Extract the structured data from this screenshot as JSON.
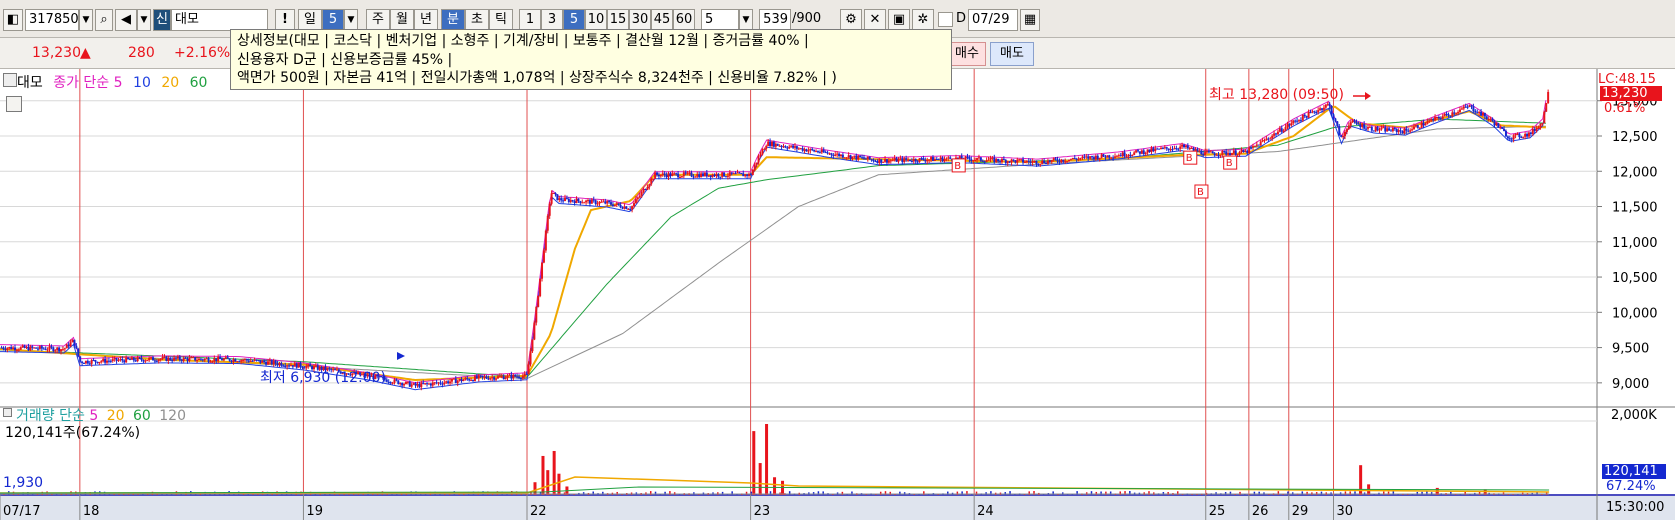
{
  "toolbar": {
    "code": "317850",
    "credit_tag": "신",
    "stock_name": "대모",
    "period_buttons": [
      "일",
      "5",
      "주",
      "월",
      "년",
      "분",
      "초",
      "틱"
    ],
    "minute_buttons": [
      "1",
      "3",
      "5",
      "10",
      "15",
      "30",
      "45",
      "60"
    ],
    "interval_value": "5",
    "count_value": "539",
    "count_total": "/900",
    "check_label": "D",
    "date_value": "07/29"
  },
  "quote": {
    "price": "13,230",
    "direction": "▲",
    "change": "280",
    "change_pct": "+2.16%",
    "buy_label": "매수",
    "sell_label": "매도"
  },
  "tooltip": {
    "line1": "상세정보(대모  |  코스닥  |  벤처기업  |  소형주  |  기계/장비  |  보통주  |  결산월  12월  |  증거금률  40%  |",
    "line2": "신용융자 D군  |  신용보증금률  45%  |",
    "line3": "액면가 500원  |  자본금  41억  |  전일시가총액  1,078억  |  상장주식수  8,324천주  |  신용비율  7.82%  |  )"
  },
  "price_legend": {
    "name": "대모",
    "title": "종가 단순",
    "periods": [
      "5",
      "10",
      "20",
      "60"
    ]
  },
  "volume_legend": {
    "title": "거래량 단순",
    "periods": [
      "5",
      "20",
      "60",
      "120"
    ],
    "value_text": "120,141주(67.24%)",
    "low_text": "1,930"
  },
  "annotations": {
    "high": "최고 13,280 (09:50)",
    "low": "최저 6,930 (12:00)",
    "signal": "B"
  },
  "right_axis": {
    "top_label": "LC:48.15",
    "price_box": "13,230",
    "pct_label": "0.61%",
    "volume_box": "120,141",
    "volume_pct": "67.24%",
    "volume_max": "2,000K",
    "time": "15:30:00"
  },
  "colors": {
    "up": "#e8141c",
    "down": "#1428d0",
    "ma5": "#e020c0",
    "ma10": "#2040e0",
    "ma20": "#f0a800",
    "ma60": "#20a040",
    "ma120": "#909090",
    "separator": "#e05050"
  },
  "chart_data": {
    "type": "candlestick",
    "y_axis": {
      "ticks": [
        "13,000",
        "12,500",
        "12,000",
        "11,500",
        "11,000",
        "10,500",
        "10,000",
        "9,500",
        "9,000"
      ],
      "ylim": [
        8700,
        13450
      ]
    },
    "x_labels": [
      {
        "label": "07/17",
        "x": 0
      },
      {
        "label": "18",
        "x": 0.05
      },
      {
        "label": "19",
        "x": 0.19
      },
      {
        "label": "22",
        "x": 0.33
      },
      {
        "label": "23",
        "x": 0.47
      },
      {
        "label": "24",
        "x": 0.61
      },
      {
        "label": "25",
        "x": 0.755
      },
      {
        "label": "26",
        "x": 0.782
      },
      {
        "label": "29",
        "x": 0.807
      },
      {
        "label": "30",
        "x": 0.835
      }
    ],
    "close_path": [
      [
        0,
        9500
      ],
      [
        0.04,
        9480
      ],
      [
        0.046,
        9600
      ],
      [
        0.05,
        9300
      ],
      [
        0.1,
        9340
      ],
      [
        0.15,
        9330
      ],
      [
        0.19,
        9240
      ],
      [
        0.23,
        9100
      ],
      [
        0.26,
        8960
      ],
      [
        0.3,
        9070
      ],
      [
        0.33,
        9100
      ],
      [
        0.335,
        9900
      ],
      [
        0.34,
        10800
      ],
      [
        0.345,
        11700
      ],
      [
        0.35,
        11600
      ],
      [
        0.38,
        11550
      ],
      [
        0.395,
        11480
      ],
      [
        0.41,
        11950
      ],
      [
        0.47,
        11950
      ],
      [
        0.475,
        12200
      ],
      [
        0.48,
        12400
      ],
      [
        0.52,
        12250
      ],
      [
        0.55,
        12150
      ],
      [
        0.6,
        12180
      ],
      [
        0.65,
        12130
      ],
      [
        0.7,
        12230
      ],
      [
        0.74,
        12350
      ],
      [
        0.755,
        12250
      ],
      [
        0.78,
        12270
      ],
      [
        0.81,
        12700
      ],
      [
        0.832,
        12950
      ],
      [
        0.84,
        12450
      ],
      [
        0.845,
        12700
      ],
      [
        0.86,
        12600
      ],
      [
        0.88,
        12570
      ],
      [
        0.9,
        12750
      ],
      [
        0.92,
        12920
      ],
      [
        0.935,
        12700
      ],
      [
        0.945,
        12480
      ],
      [
        0.958,
        12530
      ],
      [
        0.966,
        12700
      ],
      [
        0.97,
        13230
      ]
    ],
    "ma20_path": [
      [
        0,
        9480
      ],
      [
        0.1,
        9330
      ],
      [
        0.19,
        9260
      ],
      [
        0.26,
        9040
      ],
      [
        0.33,
        9100
      ],
      [
        0.345,
        9700
      ],
      [
        0.36,
        10900
      ],
      [
        0.37,
        11450
      ],
      [
        0.395,
        11580
      ],
      [
        0.41,
        11950
      ],
      [
        0.47,
        11950
      ],
      [
        0.48,
        12200
      ],
      [
        0.55,
        12170
      ],
      [
        0.65,
        12130
      ],
      [
        0.74,
        12230
      ],
      [
        0.78,
        12250
      ],
      [
        0.81,
        12500
      ],
      [
        0.835,
        12930
      ],
      [
        0.85,
        12680
      ],
      [
        0.88,
        12620
      ],
      [
        0.92,
        12850
      ],
      [
        0.94,
        12650
      ],
      [
        0.97,
        12620
      ]
    ],
    "ma60_path": [
      [
        0,
        9470
      ],
      [
        0.19,
        9300
      ],
      [
        0.33,
        9080
      ],
      [
        0.38,
        10400
      ],
      [
        0.42,
        11350
      ],
      [
        0.45,
        11760
      ],
      [
        0.48,
        11880
      ],
      [
        0.55,
        12080
      ],
      [
        0.7,
        12180
      ],
      [
        0.8,
        12370
      ],
      [
        0.835,
        12620
      ],
      [
        0.9,
        12740
      ],
      [
        0.97,
        12680
      ]
    ],
    "ma120_path": [
      [
        0,
        9470
      ],
      [
        0.33,
        9060
      ],
      [
        0.39,
        9700
      ],
      [
        0.45,
        10700
      ],
      [
        0.5,
        11500
      ],
      [
        0.55,
        11950
      ],
      [
        0.65,
        12100
      ],
      [
        0.8,
        12280
      ],
      [
        0.9,
        12600
      ],
      [
        0.97,
        12640
      ]
    ],
    "volume_spikes": [
      {
        "x": 0.335,
        "v": 0.18
      },
      {
        "x": 0.34,
        "v": 0.55
      },
      {
        "x": 0.343,
        "v": 0.35
      },
      {
        "x": 0.347,
        "v": 0.62
      },
      {
        "x": 0.35,
        "v": 0.3
      },
      {
        "x": 0.355,
        "v": 0.12
      },
      {
        "x": 0.472,
        "v": 0.9
      },
      {
        "x": 0.476,
        "v": 0.45
      },
      {
        "x": 0.48,
        "v": 1.0
      },
      {
        "x": 0.485,
        "v": 0.25
      },
      {
        "x": 0.49,
        "v": 0.2
      },
      {
        "x": 0.852,
        "v": 0.42
      },
      {
        "x": 0.857,
        "v": 0.15
      },
      {
        "x": 0.9,
        "v": 0.1
      },
      {
        "x": 0.93,
        "v": 0.08
      }
    ],
    "day_lines": [
      0.05,
      0.19,
      0.33,
      0.47,
      0.61,
      0.755,
      0.782,
      0.807,
      0.835
    ],
    "signal_points": [
      {
        "x": 0.6,
        "y": 12090
      },
      {
        "x": 0.745,
        "y": 12200
      },
      {
        "x": 0.77,
        "y": 12130
      },
      {
        "x": 0.752,
        "y": 11720
      }
    ]
  }
}
